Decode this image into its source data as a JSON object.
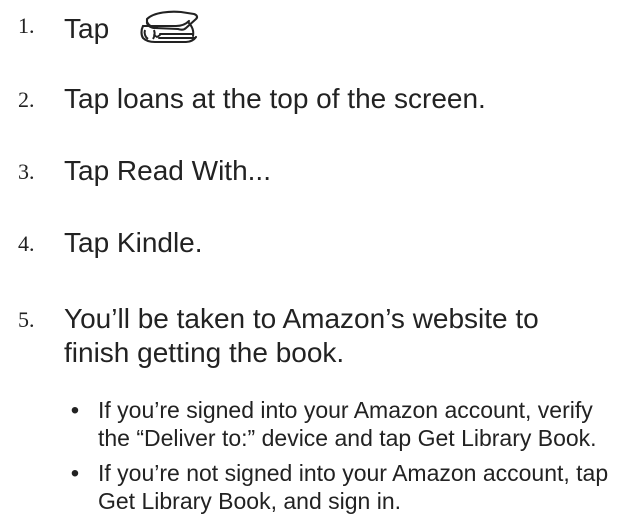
{
  "instructions": {
    "steps": [
      {
        "number": "1.",
        "text": "Tap",
        "icon": "book-stack-icon"
      },
      {
        "number": "2.",
        "text": "Tap loans at the top of the screen."
      },
      {
        "number": "3.",
        "text": "Tap Read With..."
      },
      {
        "number": "4.",
        "text": "Tap Kindle."
      },
      {
        "number": "5.",
        "text": "You’ll be taken to Amazon’s website to finish getting the book.",
        "bullets": [
          "If you’re signed into your Amazon account, verify the “Deliver to:” device and tap Get Library Book.",
          "If you’re not signed into your Amazon account, tap Get Library Book, and sign in."
        ]
      }
    ]
  }
}
